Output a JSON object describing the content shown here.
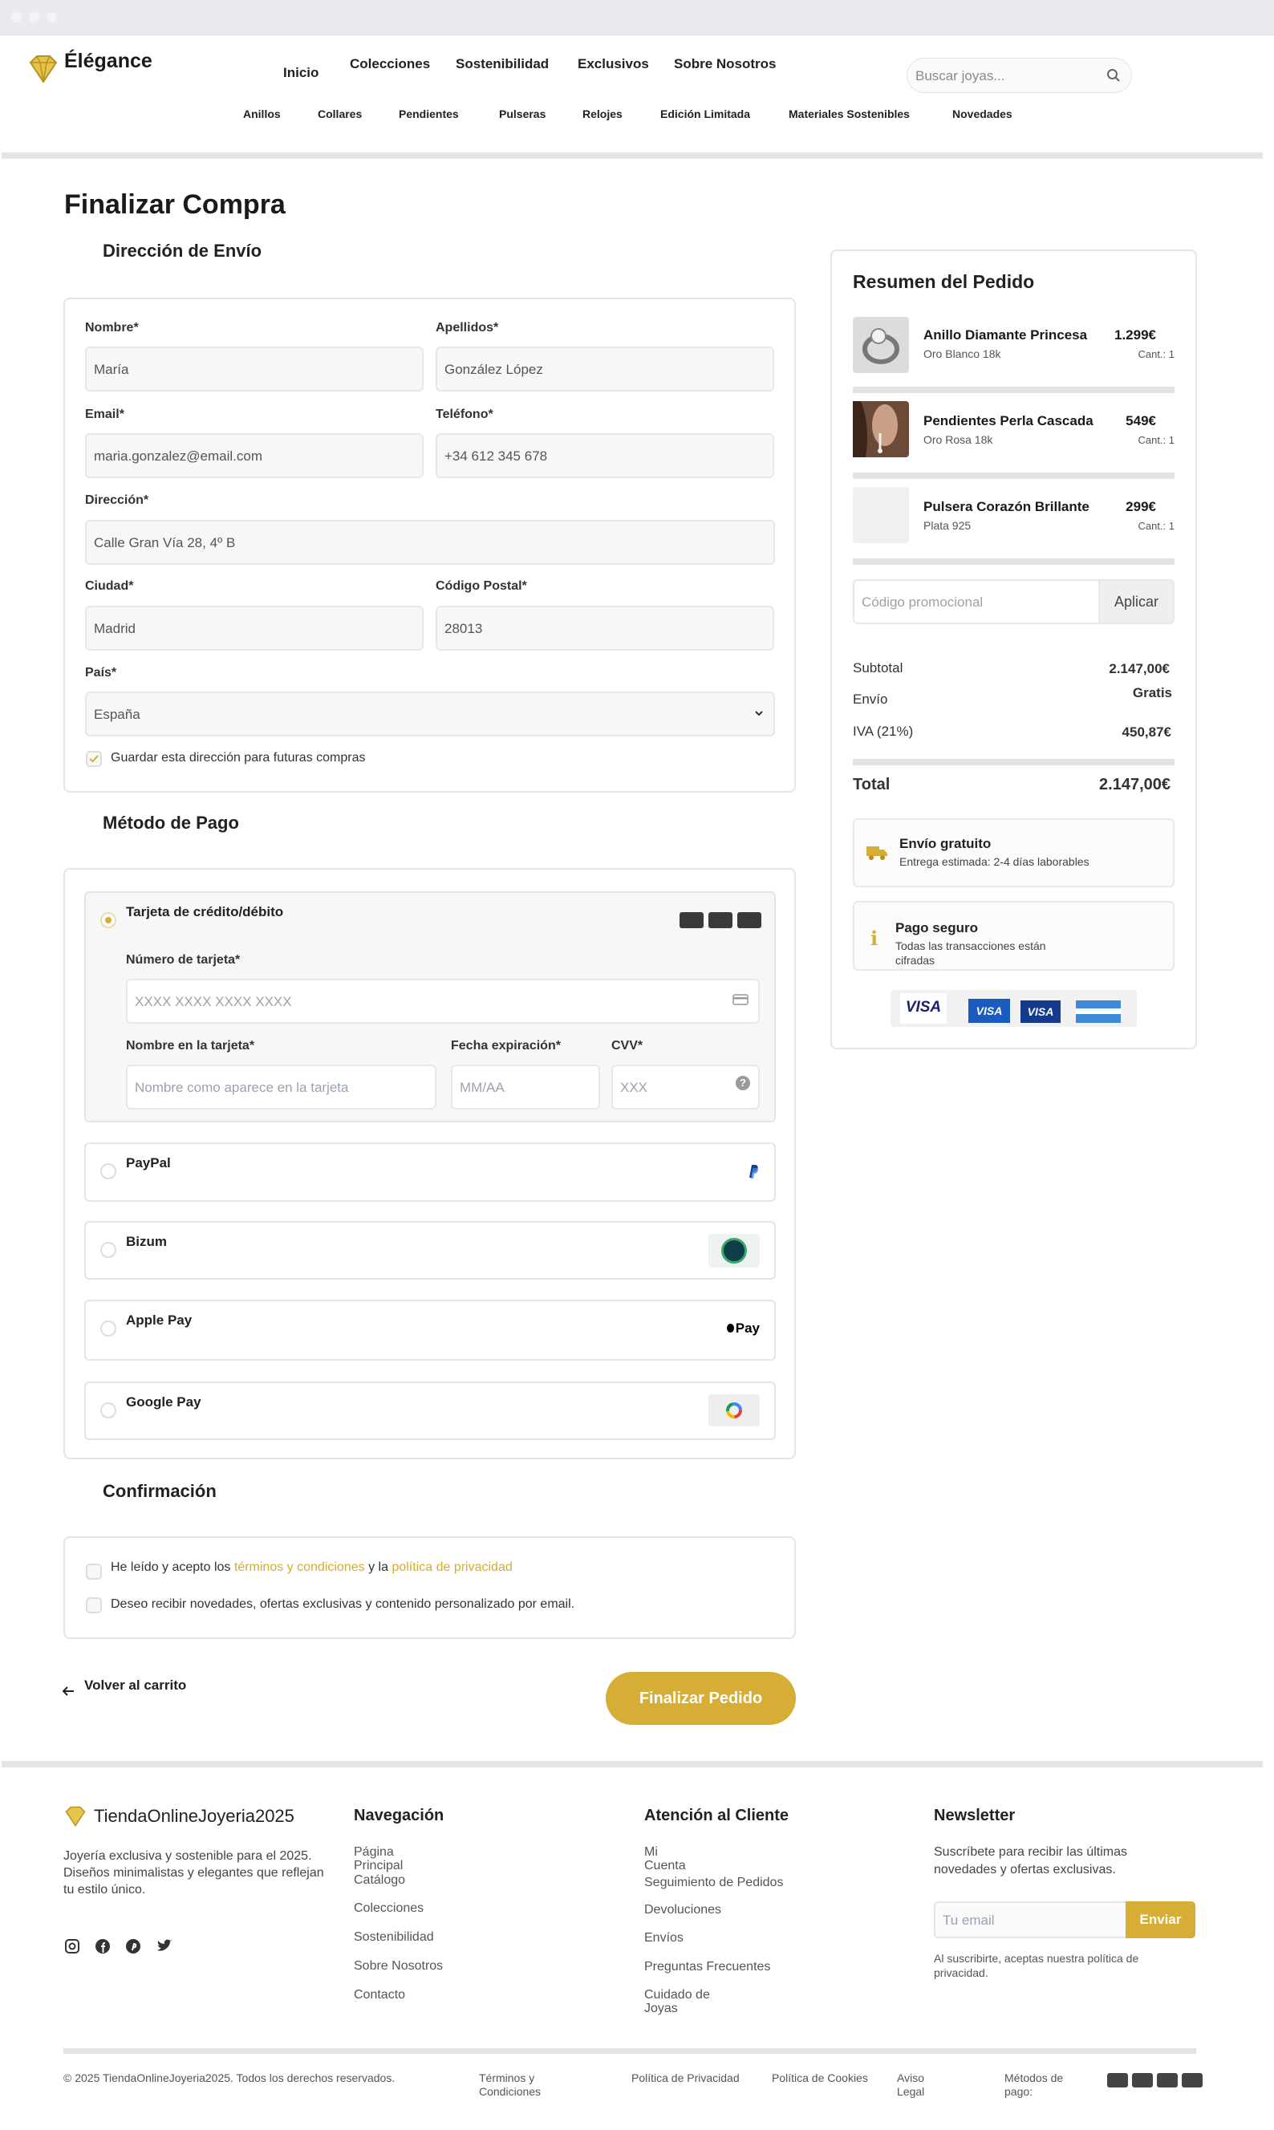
{
  "brand": {
    "name": "Élégance",
    "footer_name": "TiendaOnlineJoyeria2025",
    "accent": "#d6ae35"
  },
  "nav": {
    "main": [
      "Inicio",
      "Colecciones",
      "Sostenibilidad",
      "Exclusivos",
      "Sobre Nosotros"
    ],
    "sub": [
      "Anillos",
      "Collares",
      "Pendientes",
      "Pulseras",
      "Relojes",
      "Edición Limitada",
      "Materiales Sostenibles",
      "Novedades"
    ]
  },
  "search": {
    "placeholder": "Buscar joyas..."
  },
  "page_title": "Finalizar Compra",
  "shipping": {
    "title": "Dirección de Envío",
    "fields": {
      "nombre": {
        "label": "Nombre*",
        "value": "María"
      },
      "apellidos": {
        "label": "Apellidos*",
        "value": "González López"
      },
      "email": {
        "label": "Email*",
        "value": "maria.gonzalez@email.com"
      },
      "telefono": {
        "label": "Teléfono*",
        "value": "+34 612 345 678"
      },
      "direccion": {
        "label": "Dirección*",
        "value": "Calle Gran Vía 28, 4º B"
      },
      "ciudad": {
        "label": "Ciudad*",
        "value": "Madrid"
      },
      "cp": {
        "label": "Código Postal*",
        "value": "28013"
      },
      "pais": {
        "label": "País*",
        "value": "España"
      }
    },
    "save_label": "Guardar esta dirección para futuras compras"
  },
  "payment": {
    "title": "Método de Pago",
    "card_option": "Tarjeta de crédito/débito",
    "card_number": {
      "label": "Número de tarjeta*",
      "placeholder": "XXXX XXXX XXXX XXXX"
    },
    "card_name": {
      "label": "Nombre en la tarjeta*",
      "placeholder": "Nombre como aparece en la tarjeta"
    },
    "card_exp": {
      "label": "Fecha expiración*",
      "placeholder": "MM/AA"
    },
    "card_cvv": {
      "label": "CVV*",
      "placeholder": "XXX"
    },
    "options": [
      "PayPal",
      "Bizum",
      "Apple Pay",
      "Google Pay"
    ],
    "applepay_mark": "Pay"
  },
  "confirmation": {
    "title": "Confirmación",
    "terms_prefix": "He leído y acepto los",
    "terms_and": "y la",
    "terms_link": "términos y condiciones",
    "privacy_link": "política de privacidad",
    "newsletter_label": "Deseo recibir novedades, ofertas exclusivas y contenido personalizado por email.",
    "back_label": "Volver al carrito",
    "submit_label": "Finalizar Pedido"
  },
  "summary": {
    "title": "Resumen del Pedido",
    "items": [
      {
        "name": "Anillo Diamante Princesa",
        "variant": "Oro Blanco 18k",
        "price": "1.299€",
        "qty": "Cant.: 1"
      },
      {
        "name": "Pendientes Perla Cascada",
        "variant": "Oro Rosa 18k",
        "price": "549€",
        "qty": "Cant.: 1"
      },
      {
        "name": "Pulsera Corazón Brillante",
        "variant": "Plata 925",
        "price": "299€",
        "qty": "Cant.: 1"
      }
    ],
    "promo_placeholder": "Código promocional",
    "promo_button": "Aplicar",
    "subtotal_label": "Subtotal",
    "subtotal": "2.147,00€",
    "envio_label": "Envío",
    "envio": "Gratis",
    "iva_label": "IVA (21%)",
    "iva": "450,87€",
    "total_label": "Total",
    "total": "2.147,00€",
    "shipping_box": {
      "title": "Envío gratuito",
      "text": "Entrega estimada: 2-4 días laborables"
    },
    "secure_box": {
      "title": "Pago seguro",
      "text": "Todas las transacciones están cifradas"
    },
    "card_logos": [
      "VISA",
      "VISA",
      "VISA"
    ]
  },
  "footer": {
    "tagline": "Joyería exclusiva y sostenible para el 2025. Diseños minimalistas y elegantes que reflejan tu estilo único.",
    "nav_title": "Navegación",
    "nav_links": [
      "Página Principal",
      "Catálogo",
      "Colecciones",
      "Sostenibilidad",
      "Sobre Nosotros",
      "Contacto"
    ],
    "care_title": "Atención al Cliente",
    "care_links": [
      "Mi Cuenta",
      "Seguimiento de Pedidos",
      "Devoluciones",
      "Envíos",
      "Preguntas Frecuentes",
      "Cuidado de Joyas"
    ],
    "newsletter_title": "Newsletter",
    "newsletter_text": "Suscríbete para recibir las últimas novedades y ofertas exclusivas.",
    "newsletter_placeholder": "Tu email",
    "newsletter_button": "Enviar",
    "newsletter_note": "Al suscribirte, aceptas nuestra política de privacidad.",
    "copyright": "© 2025 TiendaOnlineJoyeria2025. Todos los derechos reservados.",
    "legal_links": [
      "Términos y Condiciones",
      "Política de Privacidad",
      "Política de Cookies",
      "Aviso Legal"
    ],
    "payment_label": "Métodos de pago:"
  }
}
